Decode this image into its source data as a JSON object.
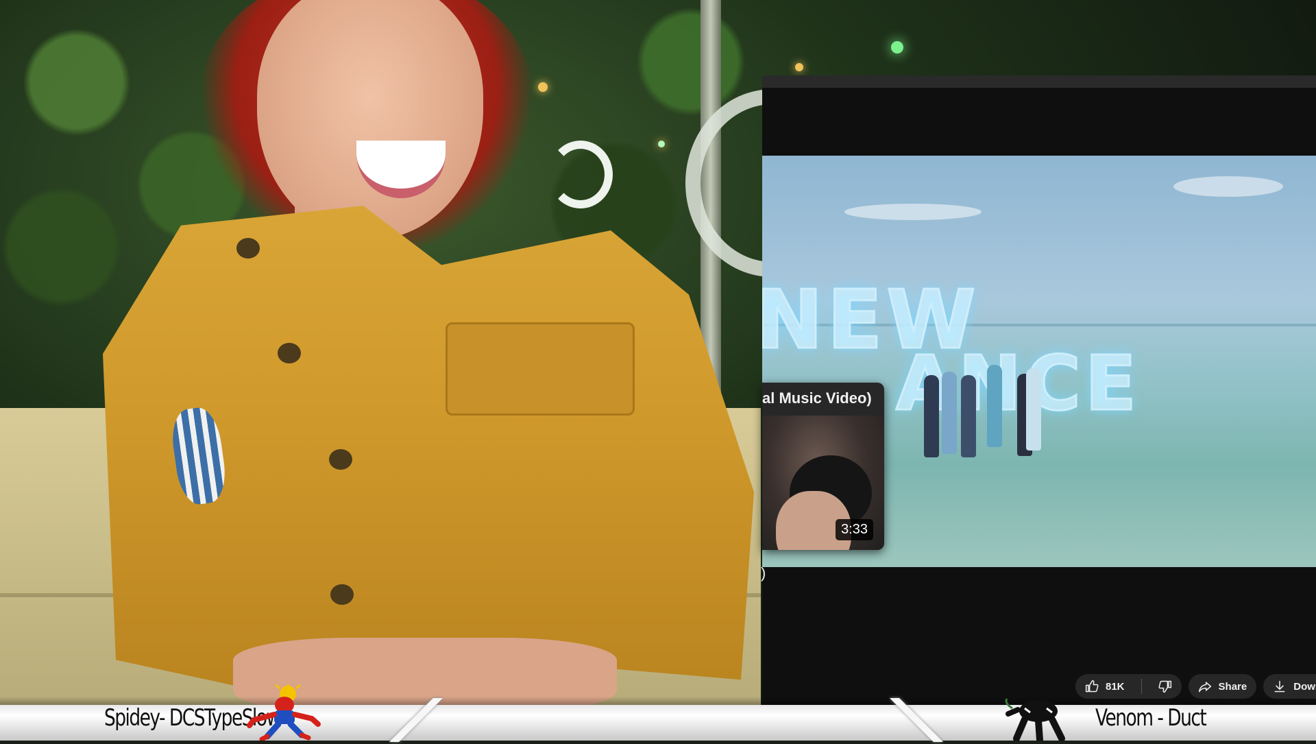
{
  "stream": {
    "left_player_label": "Spidey- DCSTypeSlow",
    "right_player_label": "Venom - Duct"
  },
  "youtube": {
    "video_title_overlay_line1": "NEW",
    "video_title_overlay_line2": "ANCE",
    "title_fragment": ")",
    "hover_preview": {
      "title": "al Music Video)",
      "duration": "3:33"
    },
    "actions": {
      "like_count": "81K",
      "share_label": "Share",
      "download_label": "Downl"
    }
  },
  "icons": {
    "like": "thumbs-up-icon",
    "dislike": "thumbs-down-icon",
    "share": "share-arrow-icon",
    "download": "download-icon"
  },
  "colors": {
    "youtube_background": "#0f0f0f",
    "button_background": "#272727",
    "jacket": "#d9a537",
    "hair": "#c4321f"
  }
}
